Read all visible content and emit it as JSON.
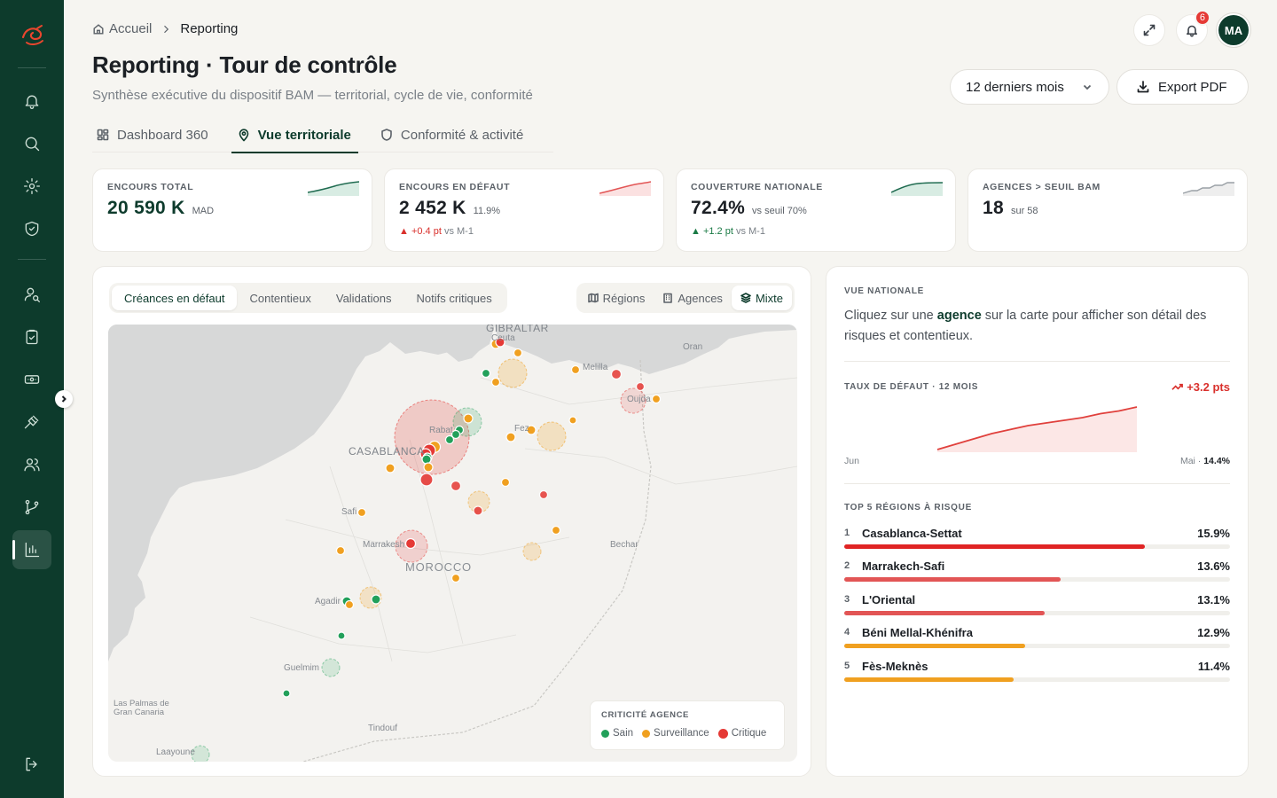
{
  "sidebar": {
    "logo": "brand-logo",
    "items": [
      {
        "name": "notifications",
        "icon": "bell-icon"
      },
      {
        "name": "search",
        "icon": "search-icon"
      },
      {
        "name": "settings",
        "icon": "gear-icon"
      },
      {
        "name": "security",
        "icon": "shield-check-icon"
      },
      {
        "name": "user-search",
        "icon": "user-search-icon"
      },
      {
        "name": "validations",
        "icon": "clipboard-check-icon"
      },
      {
        "name": "payments",
        "icon": "banknote-icon"
      },
      {
        "name": "litigation",
        "icon": "gavel-icon"
      },
      {
        "name": "users",
        "icon": "users-icon"
      },
      {
        "name": "workflow",
        "icon": "git-branch-icon"
      },
      {
        "name": "reporting",
        "icon": "bar-chart-icon",
        "active": true
      }
    ],
    "logout_icon": "logout-icon"
  },
  "breadcrumb": {
    "home": "Accueil",
    "current": "Reporting"
  },
  "header": {
    "title": "Reporting · Tour de contrôle",
    "subtitle": "Synthèse exécutive du dispositif BAM — territorial, cycle de vie, conformité",
    "notif_count": "6",
    "avatar_initials": "MA",
    "period": "12 derniers mois",
    "export_label": "Export PDF"
  },
  "tabs": [
    {
      "label": "Dashboard 360",
      "icon": "grid-icon",
      "active": false
    },
    {
      "label": "Vue territoriale",
      "icon": "map-pin-icon",
      "active": true
    },
    {
      "label": "Conformité & activité",
      "icon": "shield-icon",
      "active": false
    }
  ],
  "kpis": [
    {
      "label": "ENCOURS TOTAL",
      "value": "20 590 K",
      "unit": "MAD",
      "delta": "",
      "delta_suffix": "",
      "trend": "up",
      "color": "#1f6b50"
    },
    {
      "label": "ENCOURS EN DÉFAUT",
      "value": "2 452 K",
      "unit": "11.9%",
      "delta": "▲ +0.4 pt",
      "delta_suffix": "vs M-1",
      "trend": "up",
      "color": "#e25555"
    },
    {
      "label": "COUVERTURE NATIONALE",
      "value": "72.4%",
      "unit": "vs seuil 70%",
      "delta": "▲ +1.2 pt",
      "delta_suffix": "vs M-1",
      "trend": "up",
      "color": "#1f6b50"
    },
    {
      "label": "AGENCES > SEUIL BAM",
      "value": "18",
      "unit": "sur 58",
      "delta": "",
      "delta_suffix": "",
      "trend": "step",
      "color": "#9aa0a6"
    }
  ],
  "map": {
    "metric_tabs": [
      {
        "label": "Créances en défaut",
        "active": true
      },
      {
        "label": "Contentieux",
        "active": false
      },
      {
        "label": "Validations",
        "active": false
      },
      {
        "label": "Notifs critiques",
        "active": false
      }
    ],
    "layer_tabs": [
      {
        "label": "Régions",
        "icon": "map-icon",
        "active": false
      },
      {
        "label": "Agences",
        "icon": "building-icon",
        "active": false
      },
      {
        "label": "Mixte",
        "icon": "layers-icon",
        "active": true
      }
    ],
    "places": [
      "GIBRALTAR",
      "Ceuta",
      "Melilla",
      "Oran",
      "Oujda",
      "Rabat",
      "Fez",
      "CASABLANCA",
      "Safi",
      "Marrakesh",
      "MOROCCO",
      "Bechar",
      "Agadir",
      "Guelmim",
      "Las Palmas de",
      "Gran Canaria",
      "Tindouf",
      "Laayoune"
    ],
    "legend": {
      "title": "CRITICITÉ AGENCE",
      "items": [
        {
          "label": "Sain",
          "color": "#22a05a"
        },
        {
          "label": "Surveillance",
          "color": "#f0a020"
        },
        {
          "label": "Critique",
          "color": "#e53935"
        }
      ]
    }
  },
  "national": {
    "title": "VUE NATIONALE",
    "intro_before": "Cliquez sur une ",
    "intro_bold": "agence",
    "intro_after": " sur la carte pour afficher son détail des risques et contentieux.",
    "rate_title": "TAUX DE DÉFAUT · 12 MOIS",
    "rate_delta": "+3.2 pts",
    "rate_start": "Jun",
    "rate_end_label": "Mai · ",
    "rate_end_value": "14.4%",
    "rate_series": [
      11.2,
      11.6,
      12.0,
      12.4,
      12.7,
      13.0,
      13.2,
      13.4,
      13.6,
      13.9,
      14.1,
      14.4
    ],
    "top_title": "TOP 5 RÉGIONS À RISQUE",
    "top": [
      {
        "rank": "1",
        "name": "Casablanca-Settat",
        "value": "15.9%",
        "share": 0.78,
        "color": "#e02424"
      },
      {
        "rank": "2",
        "name": "Marrakech-Safi",
        "value": "13.6%",
        "share": 0.56,
        "color": "#e25555"
      },
      {
        "rank": "3",
        "name": "L'Oriental",
        "value": "13.1%",
        "share": 0.52,
        "color": "#e25555"
      },
      {
        "rank": "4",
        "name": "Béni Mellal-Khénifra",
        "value": "12.9%",
        "share": 0.47,
        "color": "#f0a020"
      },
      {
        "rank": "5",
        "name": "Fès-Meknès",
        "value": "11.4%",
        "share": 0.44,
        "color": "#f0a020"
      }
    ]
  }
}
